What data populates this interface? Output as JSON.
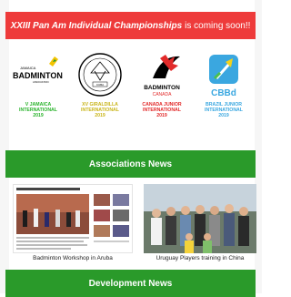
{
  "banner": {
    "highlight": "XXIII Pan Am Individual Championships",
    "rest": "is coming soon!!",
    "bg_color": "#ee3b3b"
  },
  "logos": [
    {
      "name": "jamaica-badminton",
      "logo_text": [
        "JAMAICA",
        "BADMINTON",
        "ASSOCIATION"
      ],
      "caption_lines": [
        "V JAMAICA",
        "INTERNATIONAL",
        "2019"
      ],
      "caption_color": "#29b32b"
    },
    {
      "name": "giraldilla",
      "logo_text": [
        "FEDERACION CUBANA DE BADMINTON",
        "CUBA"
      ],
      "caption_lines": [
        "XV GIRALDILLA",
        "INTERNATIONAL",
        "2019"
      ],
      "caption_color": "#c9b51a"
    },
    {
      "name": "badminton-canada",
      "logo_text": [
        "BADMINTON",
        "CANADA"
      ],
      "caption_lines": [
        "CANADA JUNIOR",
        "INTERNATIONAL",
        "2019"
      ],
      "caption_color": "#e22a2a"
    },
    {
      "name": "cbbd",
      "logo_text": [
        "CBBd"
      ],
      "caption_lines": [
        "BRAZIL JUNIOR",
        "INTERNATIONAL",
        "2019"
      ],
      "caption_color": "#3aa7e0"
    }
  ],
  "associations": {
    "title": "Associations News",
    "bg_color": "#2a9a2a"
  },
  "news": [
    {
      "caption": "Badminton Workshop in Aruba"
    },
    {
      "caption": "Uruguay Players training in China"
    }
  ],
  "development": {
    "title": "Development News"
  }
}
